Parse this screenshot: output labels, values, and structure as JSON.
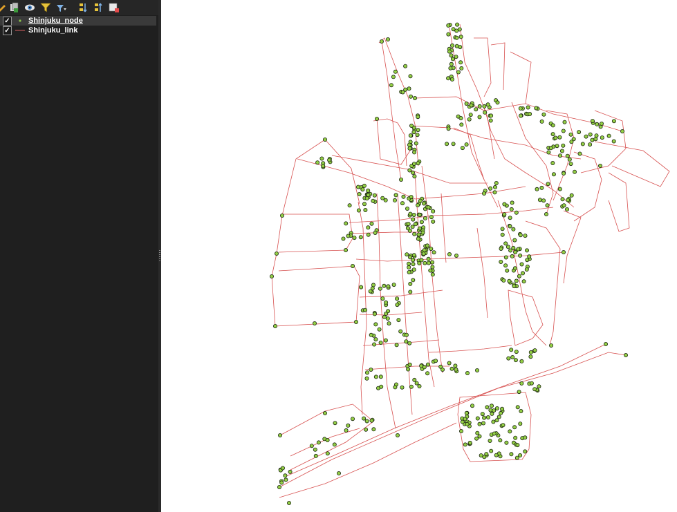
{
  "layers_panel": {
    "toolbar": [
      {
        "name": "style-manager-icon",
        "color": "#e0a028"
      },
      {
        "name": "add-group-icon",
        "color": "#d9d9d9"
      },
      {
        "name": "visibility-eye-icon",
        "color": "#7fb2e6"
      },
      {
        "name": "filter-legend-icon",
        "color": "#e6c33a"
      },
      {
        "name": "filter-expression-icon",
        "color": "#7fb2e6"
      },
      {
        "name": "expand-all-icon",
        "color": "#e6c33a"
      },
      {
        "name": "collapse-all-icon",
        "color": "#e6c33a"
      },
      {
        "name": "remove-layer-icon",
        "color": "#e24b4b"
      }
    ],
    "layers": [
      {
        "name": "Shinjuku_node",
        "checked": true,
        "checkmark": "✓",
        "geometry": "point",
        "color": "#8bc34a",
        "selected": true
      },
      {
        "name": "Shinjuku_link",
        "checked": true,
        "checkmark": "✓",
        "geometry": "line",
        "color": "#d96060",
        "selected": false
      }
    ]
  },
  "map_canvas": {
    "background": "#ffffff",
    "link_color": "#d7504f",
    "node_fill": "#93cf45",
    "node_stroke": "#1b2410"
  }
}
